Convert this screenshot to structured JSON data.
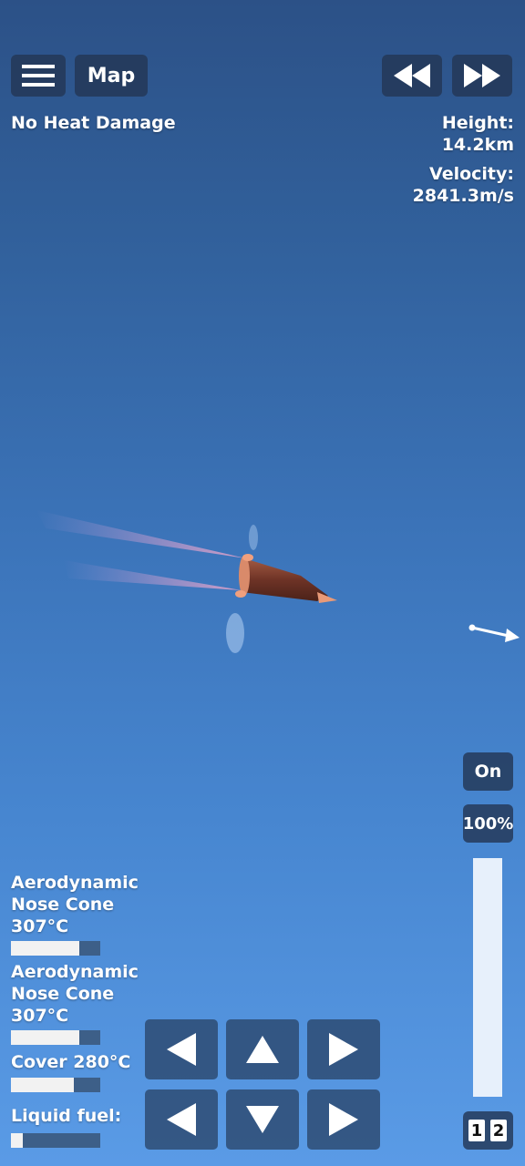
{
  "top_bar": {
    "menu_icon": "hamburger-icon",
    "map_label": "Map",
    "rewind_icon": "rewind-icon",
    "fast_forward_icon": "fast-forward-icon"
  },
  "status": {
    "heat_text": "No Heat Damage",
    "height_label": "Height:",
    "height_value": "14.2km",
    "velocity_label": "Velocity:",
    "velocity_value": "2841.3m/s"
  },
  "right_panel": {
    "on_label": "On",
    "throttle_label": "100%",
    "throttle_level": 1.0,
    "stage_1": "1",
    "stage_2": "2"
  },
  "parts": [
    {
      "line1": "Aerodynamic",
      "line2": "Nose Cone",
      "temp": "307°C",
      "fill": 0.77
    },
    {
      "line1": "Aerodynamic",
      "line2": "Nose Cone",
      "temp": "307°C",
      "fill": 0.77
    },
    {
      "name_temp": "Cover 280°C",
      "fill": 0.7
    },
    {
      "name": "Liquid fuel:",
      "fill": 0.13
    }
  ],
  "controls": {
    "row1": [
      "left-arrow-icon",
      "up-arrow-icon",
      "right-arrow-icon"
    ],
    "row2": [
      "rotate-left-icon",
      "down-arrow-icon",
      "rotate-right-icon"
    ]
  },
  "colors": {
    "sky_top": "#2c5187",
    "sky_bottom": "#5a9be6",
    "button_bg": "#233755",
    "bar_fill": "#f2f2f2",
    "bar_bg": "#3d5f88",
    "rocket_body": "#7a3a2a"
  }
}
